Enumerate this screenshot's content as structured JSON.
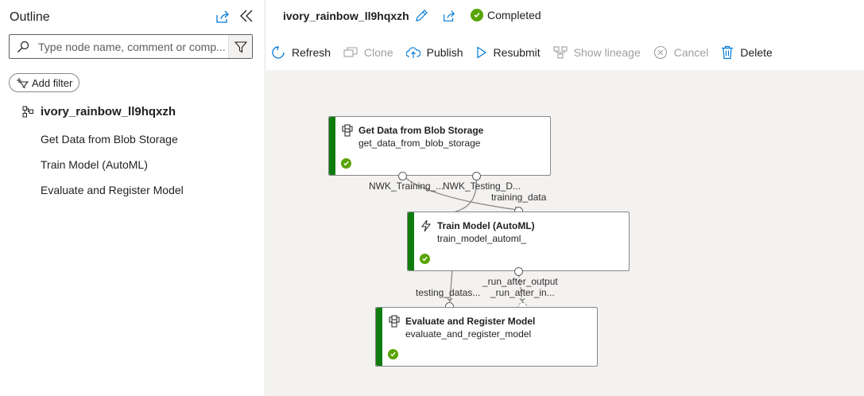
{
  "outline": {
    "title": "Outline",
    "search_placeholder": "Type node name, comment or comp...",
    "add_filter_label": "Add filter",
    "root_label": "ivory_rainbow_ll9hqxzh",
    "items": [
      {
        "label": "Get Data from Blob Storage"
      },
      {
        "label": "Train Model (AutoML)"
      },
      {
        "label": "Evaluate and Register Model"
      }
    ]
  },
  "header": {
    "run_name": "ivory_rainbow_ll9hqxzh",
    "status": "Completed",
    "status_color": "#57a300"
  },
  "toolbar": {
    "refresh": "Refresh",
    "clone": "Clone",
    "publish": "Publish",
    "resubmit": "Resubmit",
    "show_lineage": "Show lineage",
    "cancel": "Cancel",
    "delete": "Delete"
  },
  "nodes": {
    "get_data": {
      "title": "Get Data from Blob Storage",
      "subtitle": "get_data_from_blob_storage",
      "status": "completed"
    },
    "train": {
      "title": "Train Model (AutoML)",
      "subtitle": "train_model_automl_",
      "status": "completed"
    },
    "evaluate": {
      "title": "Evaluate and Register Model",
      "subtitle": "evaluate_and_register_model",
      "status": "completed"
    }
  },
  "ports": {
    "nwk_training": "NWK_Training_...",
    "nwk_testing": "NWK_Testing_D...",
    "training_data": "training_data",
    "run_after_output": "_run_after_output",
    "testing_datas": "testing_datas...",
    "run_after_in": "_run_after_in..."
  },
  "colors": {
    "accent_blue": "#0078d4",
    "success_green": "#107c10",
    "check_green": "#57a300",
    "canvas_bg": "#f3f2f1"
  }
}
